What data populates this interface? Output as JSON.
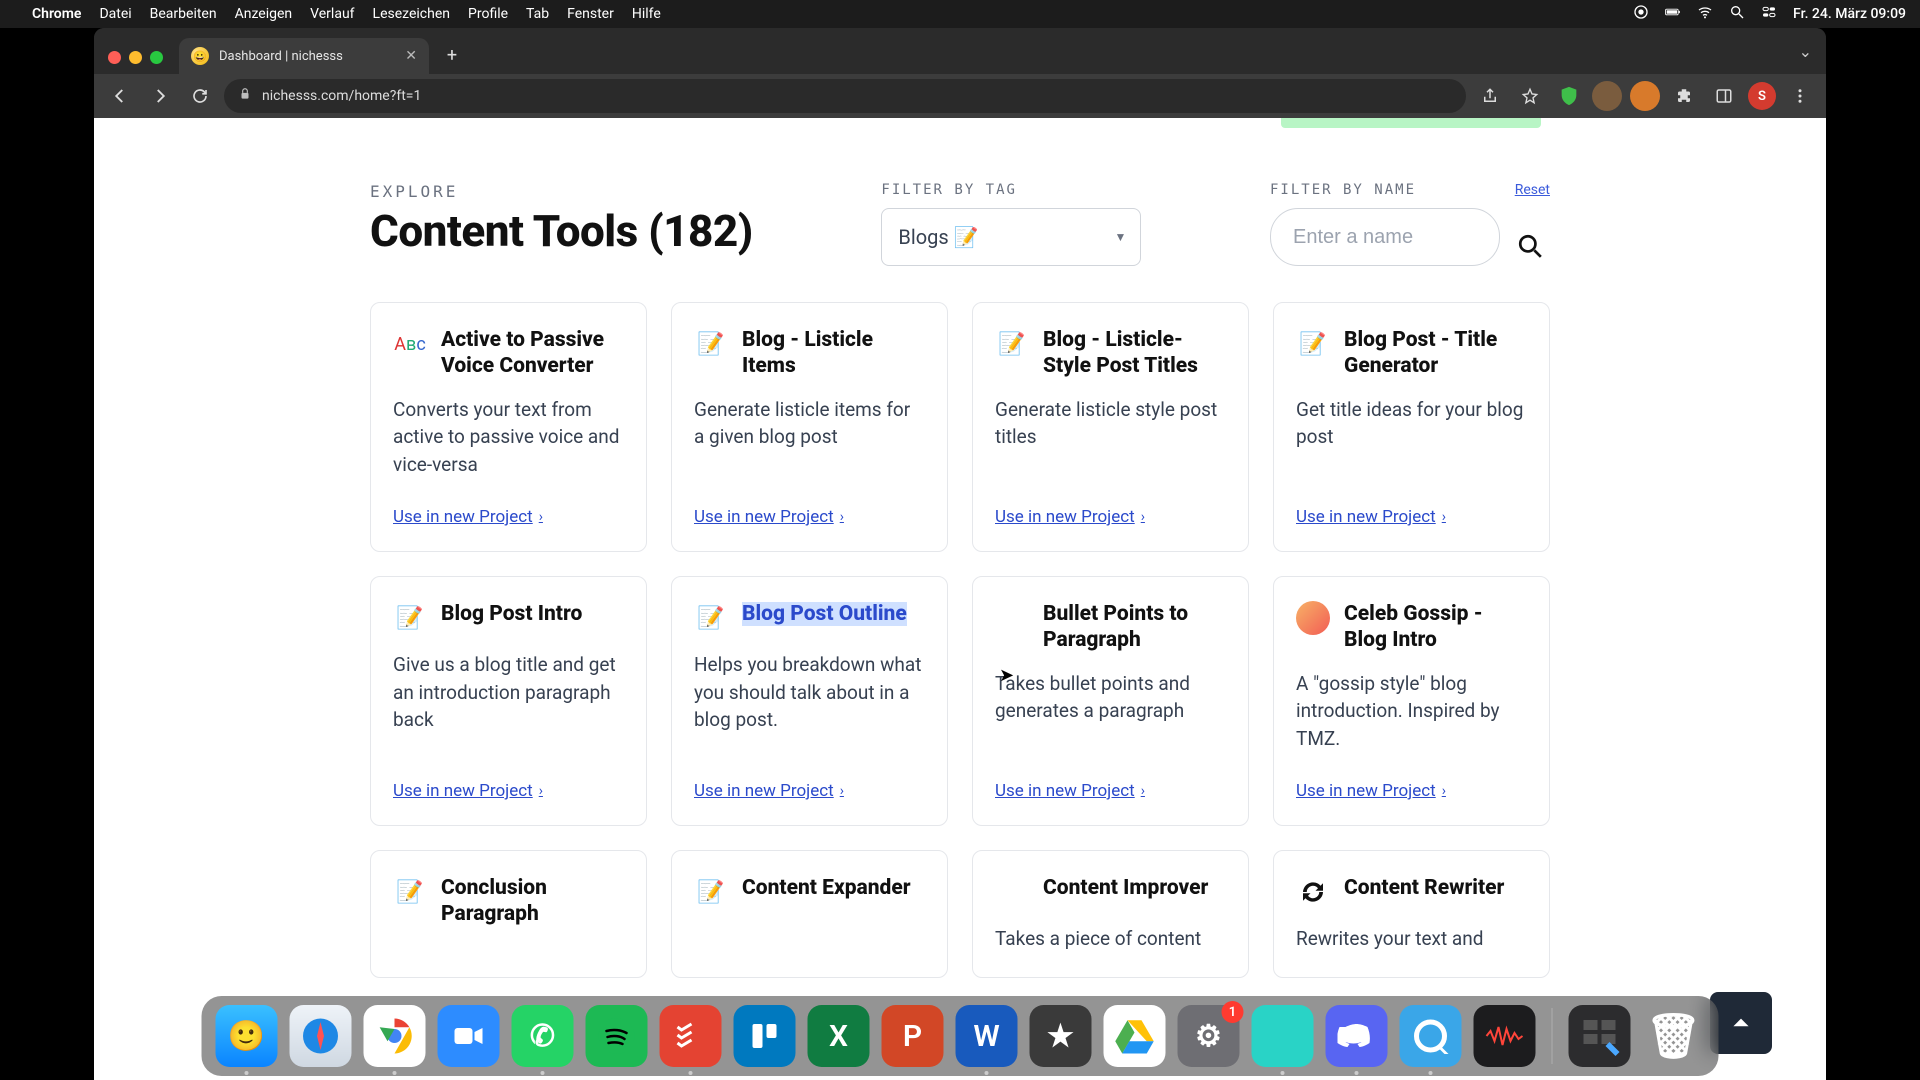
{
  "menubar": {
    "app": "Chrome",
    "items": [
      "Datei",
      "Bearbeiten",
      "Anzeigen",
      "Verlauf",
      "Lesezeichen",
      "Profile",
      "Tab",
      "Fenster",
      "Hilfe"
    ],
    "clock": "Fr. 24. März 09:09"
  },
  "browser": {
    "tab_title": "Dashboard | nichesss",
    "url": "nichesss.com/home?ft=1",
    "avatar_letter": "S"
  },
  "page": {
    "explore_label": "EXPLORE",
    "heading_text": "Content Tools",
    "heading_count": "(182)",
    "filter_tag_label": "FILTER BY TAG",
    "filter_tag_value": "Blogs 📝",
    "filter_name_label": "FILTER BY NAME",
    "reset_label": "Reset",
    "search_placeholder": "Enter a name",
    "cta_label": "Use in new Project"
  },
  "cards": [
    {
      "icon": "abc",
      "title": "Active to Passive Voice Converter",
      "desc": "Converts your text from active to passive voice and vice-versa"
    },
    {
      "icon": "blog",
      "title": "Blog - Listicle Items",
      "desc": "Generate listicle items for a given blog post"
    },
    {
      "icon": "blog",
      "title": "Blog - Listicle-Style Post Titles",
      "desc": "Generate listicle style post titles"
    },
    {
      "icon": "blog",
      "title": "Blog Post - Title Generator",
      "desc": "Get title ideas for your blog post"
    },
    {
      "icon": "blog",
      "title": "Blog Post Intro",
      "desc": "Give us a blog title and get an introduction paragraph back"
    },
    {
      "icon": "blog",
      "title": "Blog Post Outline",
      "desc": "Helps you breakdown what you should talk about in a blog post.",
      "highlighted": true
    },
    {
      "icon": "none",
      "title": "Bullet Points to Paragraph",
      "desc": "Takes bullet points and generates a paragraph"
    },
    {
      "icon": "celeb",
      "title": "Celeb Gossip - Blog Intro",
      "desc": "A \"gossip style\" blog introduction. Inspired by TMZ."
    },
    {
      "icon": "blog",
      "title": "Conclusion Paragraph",
      "desc": ""
    },
    {
      "icon": "blog",
      "title": "Content Expander",
      "desc": ""
    },
    {
      "icon": "none",
      "title": "Content Improver",
      "desc": "Takes a piece of content"
    },
    {
      "icon": "rewrite",
      "title": "Content Rewriter",
      "desc": "Rewrites your text and"
    }
  ],
  "dock": {
    "settings_badge": "1"
  }
}
